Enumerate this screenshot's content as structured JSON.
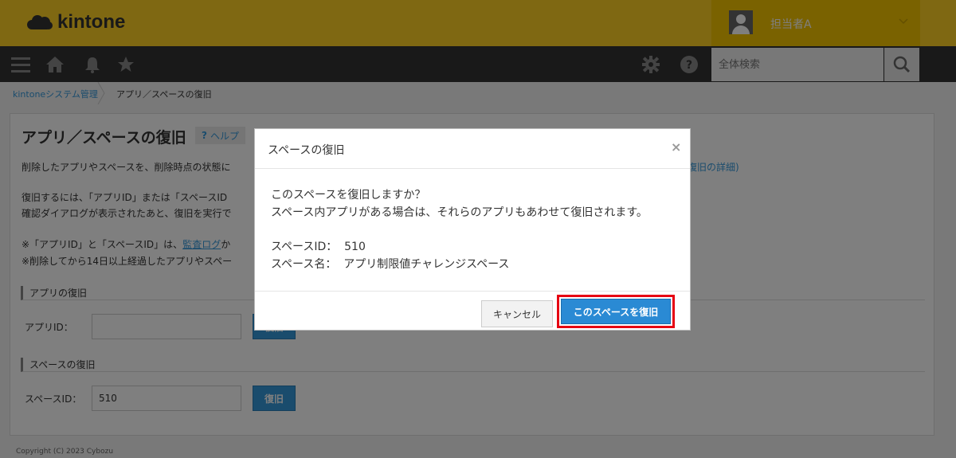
{
  "header": {
    "logo_text": "kintone",
    "username": "担当者A"
  },
  "navbar": {
    "icons": [
      "menu-icon",
      "home-icon",
      "bell-icon",
      "star-icon",
      "gear-icon",
      "help-icon",
      "search-icon"
    ],
    "search_placeholder": "全体検索"
  },
  "breadcrumb": {
    "items": [
      "kintoneシステム管理",
      "アプリ／スペースの復旧"
    ]
  },
  "page": {
    "title": "アプリ／スペースの復旧",
    "help_label": "ヘルプ",
    "desc_line1": "削除したアプリやスペースを、削除時点の状態に",
    "detail_link": "復旧の詳細)",
    "desc_line2": "復旧するには、「アプリID」または「スペースID",
    "desc_line3": "確認ダイアログが表示されたあと、復旧を実行で",
    "note1_prefix": "※「アプリID」と「スペースID」は、",
    "note1_link": "監査ログ",
    "note1_suffix": "か",
    "note2": "※削除してから14日以上経過したアプリやスペー",
    "app_section_title": "アプリの復旧",
    "app_id_label": "アプリID：",
    "app_id_value": "",
    "space_section_title": "スペースの復旧",
    "space_id_label": "スペースID：",
    "space_id_value": "510",
    "restore_label": "復旧"
  },
  "footer": {
    "copyright": "Copyright (C) 2023 Cybozu"
  },
  "modal": {
    "title": "スペースの復旧",
    "close": "×",
    "line1": "このスペースを復旧しますか？",
    "line2": "スペース内アプリがある場合は、それらのアプリもあわせて復旧されます。",
    "space_id_line": "スペースID：  510",
    "space_name_line": "スペース名：  アプリ制限値チャレンジスペース",
    "cancel_label": "キャンセル",
    "confirm_label": "このスペースを復旧"
  },
  "colors": {
    "header_yellow": "#ffd024",
    "nav_dark": "#333333",
    "link_blue": "#3498db",
    "highlight_red": "#e60012"
  }
}
